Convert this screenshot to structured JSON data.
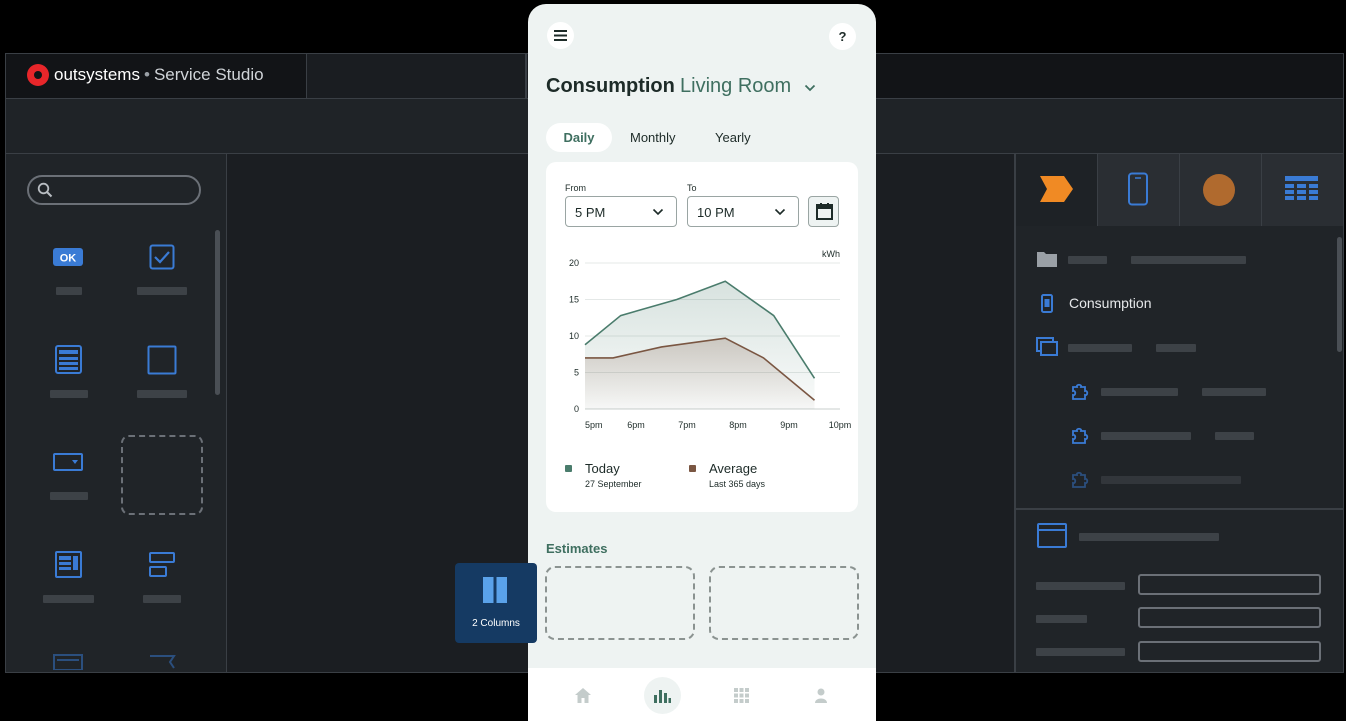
{
  "ide": {
    "brand": "outsystems",
    "product": "Service Studio"
  },
  "screen": {
    "title": "Consumption",
    "location": "Living Room",
    "tabs": [
      {
        "label": "Daily",
        "active": true
      },
      {
        "label": "Monthly",
        "active": false
      },
      {
        "label": "Yearly",
        "active": false
      }
    ],
    "from_label": "From",
    "from_value": "5 PM",
    "to_label": "To",
    "to_value": "10 PM",
    "estimates_title": "Estimates",
    "legend": [
      {
        "name": "Today",
        "sub": "27 September",
        "color": "#4a7c6c"
      },
      {
        "name": "Average",
        "sub": "Last 365 days",
        "color": "#7a5642"
      }
    ]
  },
  "chart_data": {
    "type": "area",
    "unit_label": "kWh",
    "x_ticks": [
      "5pm",
      "6pm",
      "7pm",
      "8pm",
      "9pm",
      "10pm"
    ],
    "y_ticks": [
      0,
      5,
      10,
      15,
      20
    ],
    "ylim": [
      0,
      20
    ],
    "xlim": [
      0,
      5
    ],
    "grid": true,
    "series": [
      {
        "name": "Today",
        "color": "#4a7c6c",
        "x": [
          0,
          0.7,
          1.8,
          2.75,
          3.7,
          4.5
        ],
        "y": [
          8.8,
          12.8,
          15.0,
          17.5,
          12.8,
          4.2
        ]
      },
      {
        "name": "Average",
        "color": "#7a5642",
        "x": [
          0,
          0.55,
          1.5,
          2.75,
          3.5,
          4.5
        ],
        "y": [
          7.0,
          7.0,
          8.5,
          9.7,
          7.0,
          1.2
        ]
      }
    ]
  },
  "drag_chip": {
    "label": "2 Columns"
  },
  "right_panel": {
    "selected_item": "Consumption"
  },
  "colors": {
    "accent_green": "#3f6f60",
    "logo_red": "#e8262a",
    "ide_blue": "#3a7bd5",
    "orange": "#f08a24"
  }
}
